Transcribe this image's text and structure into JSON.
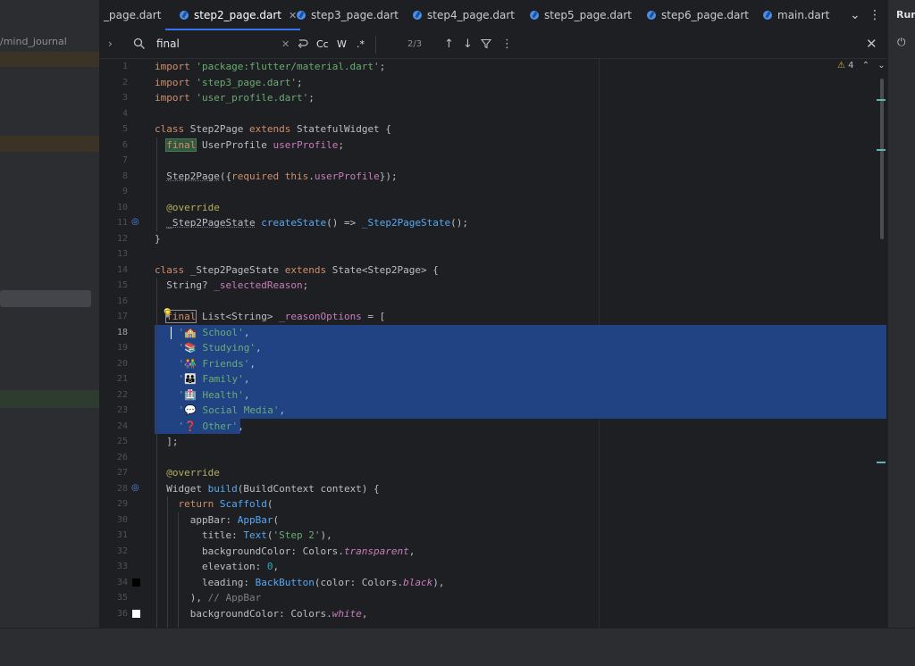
{
  "left_panel": {
    "path": "/mind_journal"
  },
  "tabs": [
    {
      "label": "_page.dart",
      "active": false
    },
    {
      "label": "step2_page.dart",
      "active": true
    },
    {
      "label": "step3_page.dart",
      "active": false
    },
    {
      "label": "step4_page.dart",
      "active": false
    },
    {
      "label": "step5_page.dart",
      "active": false
    },
    {
      "label": "step6_page.dart",
      "active": false
    },
    {
      "label": "main.dart",
      "active": false
    }
  ],
  "tab_close_glyph": "✕",
  "tab_overflow_glyph": "⌄",
  "tab_more_glyph": "⋮",
  "right_panel": {
    "title": "Run",
    "power_glyph": "⏻"
  },
  "search": {
    "query": "final",
    "match_case": "Cc",
    "whole_word": "W",
    "regex": ".*",
    "count": "2/3"
  },
  "editor": {
    "warnings_count": "4",
    "lines": [
      {
        "n": "1"
      },
      {
        "n": "2"
      },
      {
        "n": "3"
      },
      {
        "n": "4"
      },
      {
        "n": "5"
      },
      {
        "n": "6"
      },
      {
        "n": "7"
      },
      {
        "n": "8"
      },
      {
        "n": "9"
      },
      {
        "n": "10"
      },
      {
        "n": "11"
      },
      {
        "n": "12"
      },
      {
        "n": "13"
      },
      {
        "n": "14"
      },
      {
        "n": "15"
      },
      {
        "n": "16"
      },
      {
        "n": "17"
      },
      {
        "n": "18"
      },
      {
        "n": "19"
      },
      {
        "n": "20"
      },
      {
        "n": "21"
      },
      {
        "n": "22"
      },
      {
        "n": "23"
      },
      {
        "n": "24"
      },
      {
        "n": "25"
      },
      {
        "n": "26"
      },
      {
        "n": "27"
      },
      {
        "n": "28"
      },
      {
        "n": "29"
      },
      {
        "n": "30"
      },
      {
        "n": "31"
      },
      {
        "n": "32"
      },
      {
        "n": "33"
      },
      {
        "n": "34"
      },
      {
        "n": "35"
      },
      {
        "n": "36"
      }
    ],
    "code": {
      "l1": [
        "import",
        "'package:flutter/material.dart'",
        ";"
      ],
      "l2": [
        "import",
        "'step3_page.dart'",
        ";"
      ],
      "l3": [
        "import",
        "'user_profile.dart'",
        ";"
      ],
      "l5": [
        "class",
        "Step2Page",
        "extends",
        "StatefulWidget",
        "{"
      ],
      "l6": [
        "final",
        "UserProfile",
        "userProfile",
        ";"
      ],
      "l8": [
        "Step2Page",
        "({",
        "required",
        "this",
        ".",
        "userProfile",
        "});"
      ],
      "l10": [
        "@override"
      ],
      "l11": [
        "_Step2PageState",
        "createState",
        "() => ",
        "_Step2PageState",
        "();"
      ],
      "l12": [
        "}"
      ],
      "l14": [
        "class",
        "_Step2PageState",
        "extends",
        "State<Step2Page> {"
      ],
      "l15": [
        "String? ",
        "_selectedReason",
        ";"
      ],
      "l17": [
        "final",
        "List<String> ",
        "_reasonOptions",
        " = ["
      ],
      "l18": [
        "'🏫 School'",
        ","
      ],
      "l19": [
        "'📚 Studying'",
        ","
      ],
      "l20": [
        "'👫 Friends'",
        ","
      ],
      "l21": [
        "'👪 Family'",
        ","
      ],
      "l22": [
        "'🏥 Health'",
        ","
      ],
      "l23": [
        "'💬 Social Media'",
        ","
      ],
      "l24": [
        "'❓ Other'",
        ","
      ],
      "l25": [
        "];"
      ],
      "l27": [
        "@override"
      ],
      "l28": [
        "Widget ",
        "build",
        "(BuildContext context) {"
      ],
      "l29": [
        "return",
        "Scaffold",
        "("
      ],
      "l30": [
        "appBar",
        ": ",
        "AppBar",
        "("
      ],
      "l31": [
        "title",
        ": ",
        "Text",
        "(",
        "'Step 2'",
        "),"
      ],
      "l32": [
        "backgroundColor",
        ": Colors.",
        "transparent",
        ","
      ],
      "l33": [
        "elevation",
        ": ",
        "0",
        ","
      ],
      "l34": [
        "leading",
        ": ",
        "BackButton",
        "(color: Colors.",
        "black",
        "),"
      ],
      "l35": [
        "), ",
        "// AppBar"
      ],
      "l36": [
        "backgroundColor",
        ": Colors.",
        "white",
        ","
      ]
    }
  },
  "colors": {
    "accent": "#3574f0",
    "selection": "#214283",
    "keyword": "#cf8e6d",
    "string": "#6aab73",
    "function": "#56a8f5"
  }
}
